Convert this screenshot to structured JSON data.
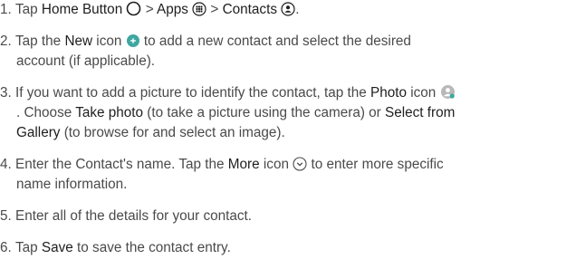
{
  "colors": {
    "text": "#4a4a4a",
    "emphasis": "#1e1e1e",
    "icon_teal": "#3fa7a2",
    "icon_gray": "#b8b8b8"
  },
  "icons": {
    "home": "circle-outline-icon",
    "apps": "apps-grid-icon",
    "contacts": "contacts-person-icon",
    "new": "plus-circle-icon",
    "photo": "photo-person-icon",
    "more": "chevron-down-circle-icon"
  },
  "steps": [
    {
      "num": "1.",
      "t1": "Tap ",
      "b1": "Home Button",
      "t2": " > ",
      "b2": "Apps",
      "t3": " > ",
      "b3": "Contacts",
      "t4": "."
    },
    {
      "num": "2.",
      "t1": "Tap the ",
      "b1": "New",
      "t2": " icon",
      "t3": " to add a new contact and select the desired",
      "line2": "account (if applicable)."
    },
    {
      "num": "3.",
      "t1": "If you want to add a picture to identify the contact, tap the ",
      "b1": "Photo",
      "t2": " icon",
      "l2a": ". Choose ",
      "l2b": "Take photo",
      "l2c": " (to take a picture using the camera) or ",
      "l2d": "Select from",
      "l3a": "Gallery",
      "l3b": " (to browse for and select an image)."
    },
    {
      "num": "4.",
      "t1": "Enter the Contact's name. Tap the ",
      "b1": "More",
      "t2": " icon",
      "t3": " to enter more specific",
      "line2": "name information."
    },
    {
      "num": "5.",
      "t1": "Enter all of the details for your contact."
    },
    {
      "num": "6.",
      "t1": "Tap ",
      "b1": "Save",
      "t2": " to save the contact entry."
    }
  ]
}
